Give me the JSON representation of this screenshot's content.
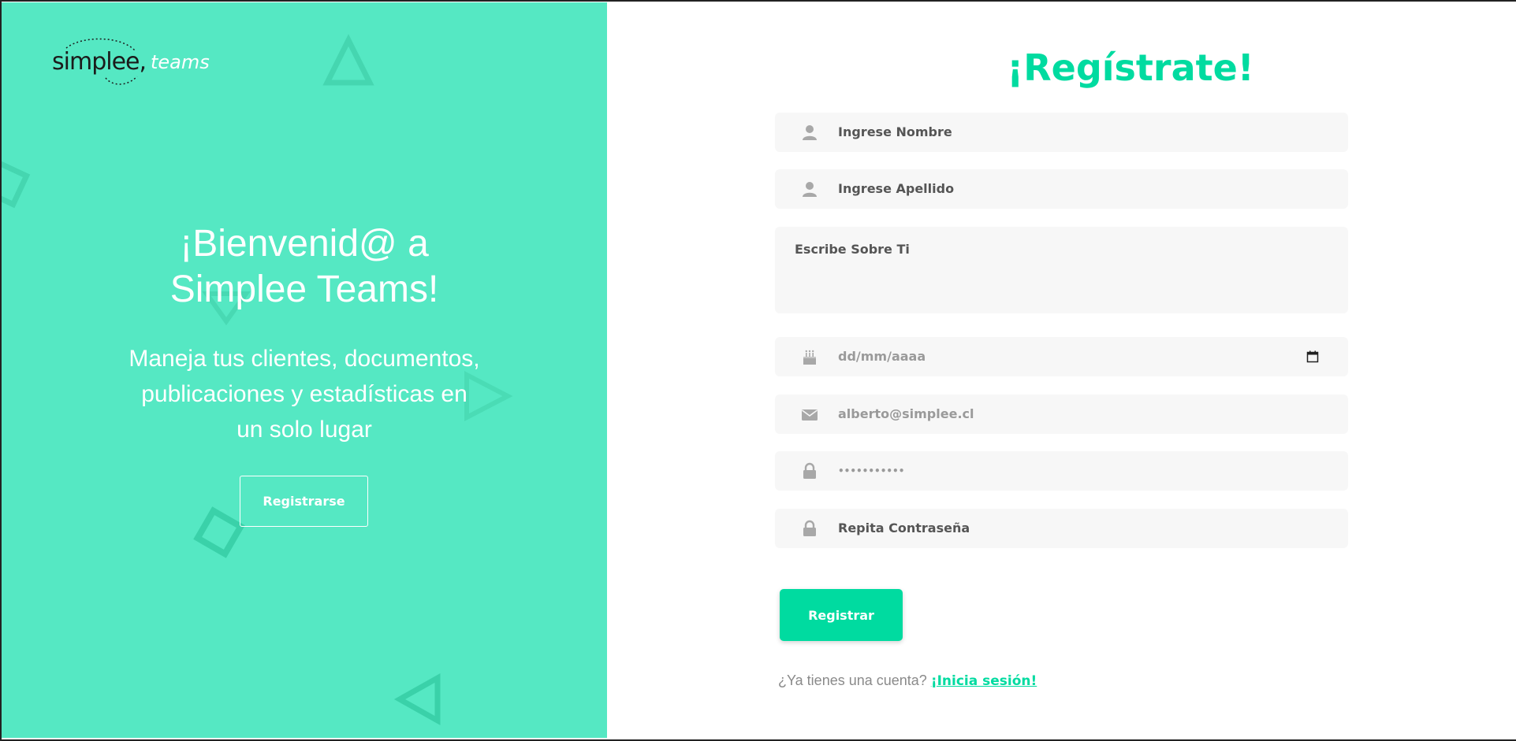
{
  "brand": {
    "logo_word": "simplee,",
    "logo_sub": "teams"
  },
  "welcome": {
    "line1": "¡Bienvenid@ a",
    "line2": "Simplee Teams!",
    "tagline_1": "Maneja tus clientes, documentos,",
    "tagline_2": "publicaciones y estadísticas en",
    "tagline_3": "un solo lugar",
    "register_button": "Registrarse"
  },
  "form": {
    "title": "¡Regístrate!",
    "first_name": {
      "placeholder": "Ingrese Nombre",
      "icon": "user-icon"
    },
    "last_name": {
      "placeholder": "Ingrese Apellido",
      "icon": "user-icon"
    },
    "about": {
      "placeholder": "Escribe Sobre Ti"
    },
    "birthdate": {
      "placeholder": "dd/mm/aaaa",
      "icon": "birthday-cake-icon"
    },
    "email": {
      "value": "alberto@simplee.cl",
      "icon": "envelope-icon"
    },
    "password": {
      "value": "•••••••••••",
      "icon": "lock-icon"
    },
    "repeat_password": {
      "placeholder": "Repita Contraseña",
      "icon": "lock-icon"
    },
    "submit_label": "Registrar",
    "have_account": "¿Ya tienes una cuenta?",
    "login_link": "¡Inicia sesión!"
  },
  "colors": {
    "left_panel": "#55e8c3",
    "accent": "#00dba0",
    "field_bg": "#f7f7f7"
  }
}
